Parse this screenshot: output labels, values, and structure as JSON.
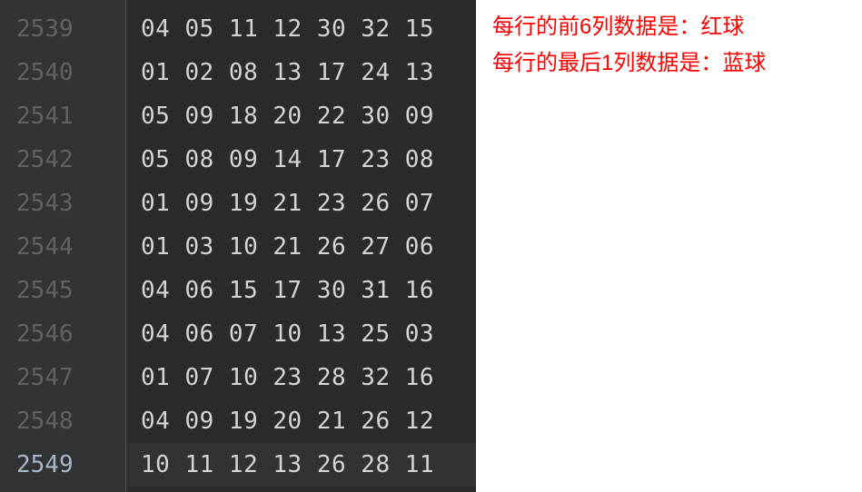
{
  "editor": {
    "lines": [
      {
        "number": "2539",
        "content": "04 05 11 12 30 32 15",
        "active": false
      },
      {
        "number": "2540",
        "content": "01 02 08 13 17 24 13",
        "active": false
      },
      {
        "number": "2541",
        "content": "05 09 18 20 22 30 09",
        "active": false
      },
      {
        "number": "2542",
        "content": "05 08 09 14 17 23 08",
        "active": false
      },
      {
        "number": "2543",
        "content": "01 09 19 21 23 26 07",
        "active": false
      },
      {
        "number": "2544",
        "content": "01 03 10 21 26 27 06",
        "active": false
      },
      {
        "number": "2545",
        "content": "04 06 15 17 30 31 16",
        "active": false
      },
      {
        "number": "2546",
        "content": "04 06 07 10 13 25 03",
        "active": false
      },
      {
        "number": "2547",
        "content": "01 07 10 23 28 32 16",
        "active": false
      },
      {
        "number": "2548",
        "content": "04 09 19 20 21 26 12",
        "active": false
      },
      {
        "number": "2549",
        "content": "10 11 12 13 26 28 11",
        "active": true
      }
    ]
  },
  "annotations": {
    "line1": "每行的前6列数据是：红球",
    "line2": "每行的最后1列数据是：蓝球"
  }
}
